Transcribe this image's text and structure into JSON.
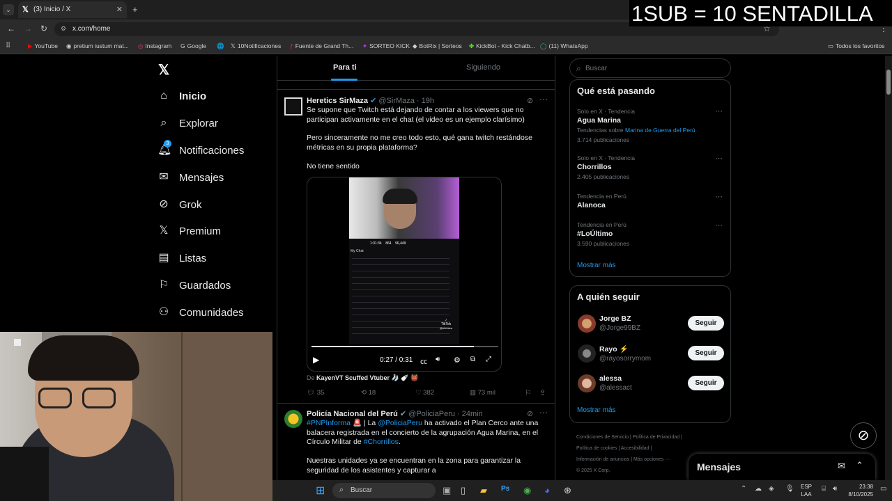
{
  "browser": {
    "tab_title": "(3) Inicio / X",
    "url": "x.com/home",
    "bookmarks": [
      "YouTube",
      "pretium iustum mat...",
      "Instagram",
      "Google",
      "10Notificaciones",
      "Fuente de Grand Th...",
      "SORTEO KICK",
      "BotRix | Sorteos",
      "KickBot - Kick Chatb...",
      "(11) WhatsApp"
    ],
    "all_favorites": "Todos los favoritos"
  },
  "overlay_text": "1SUB = 10 SENTADILLA",
  "nav": {
    "items": [
      "Inicio",
      "Explorar",
      "Notificaciones",
      "Mensajes",
      "Grok",
      "Premium",
      "Listas",
      "Guardados",
      "Comunidades"
    ],
    "notif_badge": "3"
  },
  "feed": {
    "tab_for_you": "Para ti",
    "tab_following": "Siguiendo",
    "tweet1": {
      "name": "Heretics SirMaza",
      "handle": "@SirMaza",
      "time": "· 19h",
      "text_1": "Se supone que Twitch está dejando de contar a los viewers que no participan activamente en el chat (el video es un ejemplo clarísimo)",
      "text_2": "Pero sinceramente no me creo todo esto, qué gana twitch restándose métricas en su propia plataforma?",
      "text_3": "No tiene sentido",
      "video_time": "0:27 / 0:31",
      "video_progress": 0.87,
      "from_prefix": "De",
      "from_user": "KayenVT Scuffed Vtuber",
      "from_emoji": "🧦 🍼 👹",
      "replies": "35",
      "retweets": "18",
      "likes": "382",
      "views": "73 mil",
      "stream_stats": [
        "1:31:34",
        "864",
        "96,449"
      ],
      "stream_chat_label": "My Chat",
      "tiktok_label": "TikTok",
      "tiktok_handle": "@sirmaza"
    },
    "tweet2": {
      "name": "Policía Nacional del Perú",
      "handle": "@PoliciaPeru",
      "time": "· 24min",
      "hashtag1": "#PNPInforma",
      "text_a": " 🚨 | La ",
      "mention": "@PoliciaPeru",
      "text_b": " ha activado el Plan Cerco ante una balacera registrada en el concierto de la agrupación Agua Marina, en el Círculo Militar de ",
      "hashtag2": "#Chorrillos",
      "text_c": ".",
      "text_d": "Nuestras unidades ya se encuentran en la zona para garantizar la seguridad de los asistentes y capturar a"
    }
  },
  "right": {
    "search_placeholder": "Buscar",
    "trends_title": "Qué está pasando",
    "trends": [
      {
        "meta": "Solo en X · Tendencia",
        "title": "Agua Marina",
        "sub_prefix": "Tendencias sobre ",
        "sub_link": "Marina de Guerra del Perú",
        "count": "3.714 publicaciones"
      },
      {
        "meta": "Solo en X · Tendencia",
        "title": "Chorrillos",
        "count": "2.405 publicaciones"
      },
      {
        "meta": "Tendencia en Perú",
        "title": "Alanoca"
      },
      {
        "meta": "Tendencia en Perú",
        "title": "#LoÚltimo",
        "count": "3.590 publicaciones"
      }
    ],
    "show_more": "Mostrar más",
    "who_to_follow_title": "A quién seguir",
    "follow": [
      {
        "name": "Jorge BZ",
        "handle": "@Jorge99BZ"
      },
      {
        "name": "Rayo ⚡",
        "handle": "@rayosorrymom"
      },
      {
        "name": "alessa",
        "handle": "@alessact"
      }
    ],
    "follow_button": "Seguir",
    "show_more_2": "Mostrar más",
    "footer": [
      "Condiciones de Servicio",
      "Política de Privacidad",
      "Política de cookies",
      "Accesibilidad",
      "Información de anuncios",
      "Más opciones ···",
      "© 2025 X Corp."
    ],
    "messages_title": "Mensajes"
  },
  "taskbar": {
    "search": "Buscar",
    "lang": "ESP",
    "lang2": "LAA",
    "time": "23:38",
    "date": "8/10/2025"
  }
}
